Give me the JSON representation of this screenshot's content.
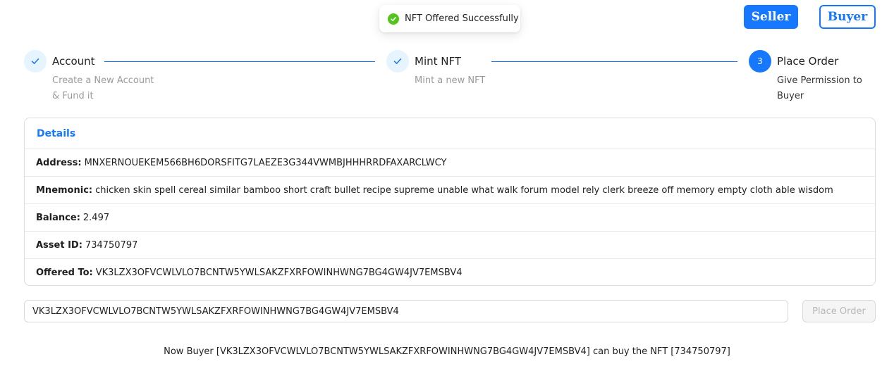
{
  "toast": {
    "message": "NFT Offered Successfully",
    "icon": "check-circle-icon",
    "color": "#52c41a"
  },
  "header": {
    "seller_label": "Seller",
    "buyer_label": "Buyer",
    "accent": "#1677ff"
  },
  "steps": [
    {
      "title": "Account",
      "desc_lines": [
        "Create a New Account",
        "& Fund it"
      ],
      "status": "finished",
      "icon": "check-icon"
    },
    {
      "title": "Mint NFT",
      "desc_lines": [
        "Mint a new NFT"
      ],
      "status": "finished",
      "icon": "check-icon"
    },
    {
      "number": "3",
      "title": "Place Order",
      "desc_lines": [
        "Give Permission to",
        "Buyer"
      ],
      "status": "current"
    }
  ],
  "details": {
    "title": "Details",
    "rows": [
      {
        "label": "Address:",
        "value": "MNXERNOUEKEM566BH6DORSFITG7LAEZE3G344VWMBJHHHRRDFAXARCLWCY"
      },
      {
        "label": "Mnemonic:",
        "value": "chicken skin spell cereal similar bamboo short craft bullet recipe supreme unable what walk forum model rely clerk breeze off memory empty cloth able wisdom"
      },
      {
        "label": "Balance:",
        "value": "2.497"
      },
      {
        "label": "Asset ID:",
        "value": "734750797"
      },
      {
        "label": "Offered To:",
        "value": "VK3LZX3OFVCWLVLO7BCNTW5YWLSAKZFXRFOWINHWNG7BG4GW4JV7EMSBV4"
      }
    ]
  },
  "order": {
    "input_value": "VK3LZX3OFVCWLVLO7BCNTW5YWLSAKZFXRFOWINHWNG7BG4GW4JV7EMSBV4",
    "button_label": "Place Order"
  },
  "status_message": "Now Buyer [VK3LZX3OFVCWLVLO7BCNTW5YWLSAKZFXRFOWINHWNG7BG4GW4JV7EMSBV4] can buy the NFT [734750797]"
}
